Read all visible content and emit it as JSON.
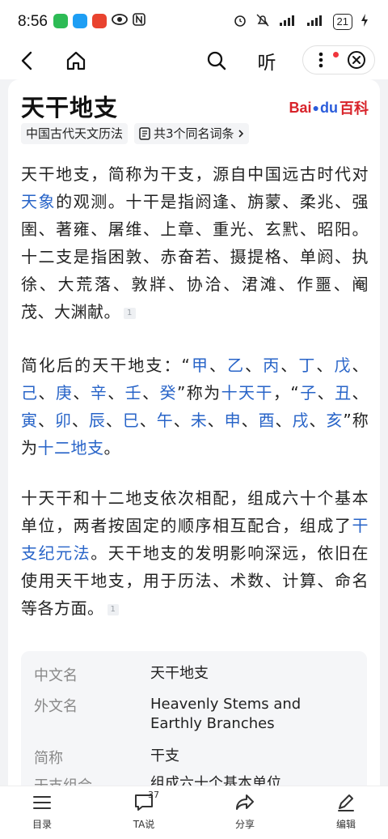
{
  "status_bar": {
    "time": "8:56",
    "battery": "21",
    "notification_icons": [
      "wechat-icon",
      "message-icon",
      "app-icon",
      "eye-icon",
      "nfc-icon"
    ],
    "system_icons": [
      "alarm-icon",
      "mute-icon",
      "signal-icon",
      "signal-icon",
      "battery-icon",
      "charging-icon"
    ]
  },
  "nav": {
    "listen_label": "听"
  },
  "article": {
    "title": "天干地支",
    "logo_text_left": "Bai",
    "logo_text_mid": "du",
    "logo_text_right": "百科",
    "chip_category": "中国古代天文历法",
    "chip_synonyms": "共3个同名词条",
    "para1": {
      "a": "天干地支，简称为干支，源自中国远古时代对",
      "link1": "天象",
      "b": "的观测。十干是指阏逢、旃蒙、柔兆、强圉、著雍、屠维、上章、重光、玄黓、昭阳。十二支是指困敦、赤奋若、摄提格、单阏、执徐、大荒落、敦牂、协洽、涒滩、作噩、阉茂、大渊献。",
      "ref": "1"
    },
    "para2": {
      "a": "简化后的天干地支：“",
      "stems": [
        "甲",
        "乙",
        "丙",
        "丁",
        "戊",
        "己",
        "庚",
        "辛",
        "壬",
        "癸"
      ],
      "b": "”称为",
      "link_stems": "十天干",
      "c": "，“",
      "branches": [
        "子",
        "丑",
        "寅",
        "卯",
        "辰",
        "巳",
        "午",
        "未",
        "申",
        "酉",
        "戌",
        "亥"
      ],
      "d": "”称为",
      "link_branches": "十二地支",
      "e": "。"
    },
    "para3": {
      "a": "十天干和十二地支依次相配，组成六十个基本单位，两者按固定的顺序相互配合，组成了",
      "link1": "干支纪元法",
      "b": "。天干地支的发明影响深远，依旧在使用天干地支，用于历法、术数、计算、命名等各方面。",
      "ref": "1"
    },
    "infobox": [
      {
        "key": "中文名",
        "value": "天干地支"
      },
      {
        "key": "外文名",
        "value": "Heavenly Stems and Earthly Branches"
      },
      {
        "key": "简称",
        "value": "干支"
      },
      {
        "key": "干支组合",
        "value": "组成六十个基本单位"
      }
    ]
  },
  "bottom_bar": {
    "items": [
      {
        "label": "目录"
      },
      {
        "label": "TA说",
        "badge": "37"
      },
      {
        "label": "分享"
      },
      {
        "label": "编辑"
      }
    ]
  }
}
